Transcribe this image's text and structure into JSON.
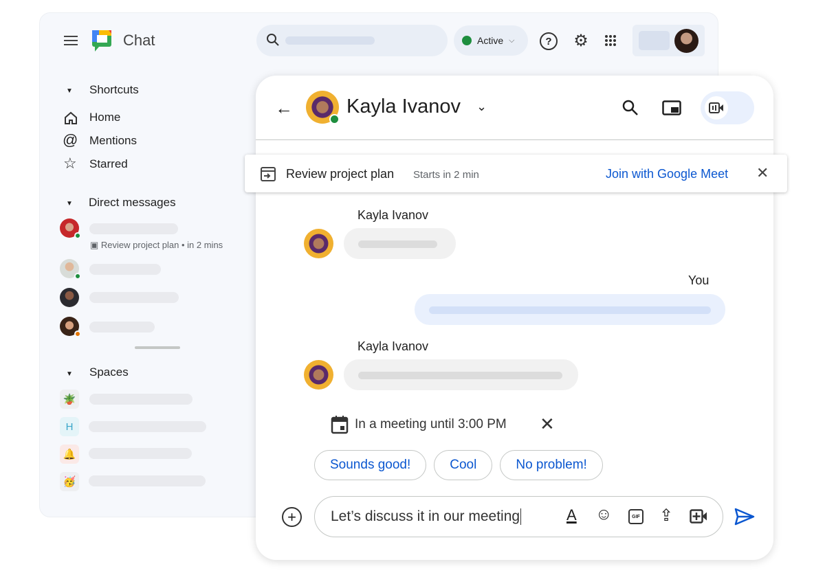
{
  "app": {
    "title": "Chat",
    "status": "Active"
  },
  "sidebar": {
    "shortcuts_label": "Shortcuts",
    "shortcuts": [
      {
        "label": "Home",
        "icon": "home-icon"
      },
      {
        "label": "Mentions",
        "icon": "at-icon"
      },
      {
        "label": "Starred",
        "icon": "star-icon"
      }
    ],
    "dm_label": "Direct messages",
    "dm_meeting": "Review project plan",
    "dm_meeting_time": "in 2 mins",
    "spaces_label": "Spaces",
    "spaces": [
      {
        "icon": "🪴"
      },
      {
        "icon": "H"
      },
      {
        "icon": "🔔"
      },
      {
        "icon": "🥳"
      }
    ]
  },
  "chat": {
    "contact": "Kayla Ivanov",
    "banner": {
      "title": "Review project plan",
      "subtitle": "Starts in 2 min",
      "action": "Join with Google Meet"
    },
    "messages": [
      {
        "sender": "Kayla Ivanov"
      },
      {
        "sender": "You"
      },
      {
        "sender": "Kayla Ivanov"
      }
    ],
    "status": "In a meeting until 3:00 PM",
    "replies": [
      "Sounds good!",
      "Cool",
      "No problem!"
    ],
    "compose_value": "Let’s discuss it in our meeting"
  },
  "colors": {
    "accent": "#0b57d0",
    "online": "#1e8e3e",
    "away": "#e37400",
    "window_bg": "#f6f8fc"
  }
}
